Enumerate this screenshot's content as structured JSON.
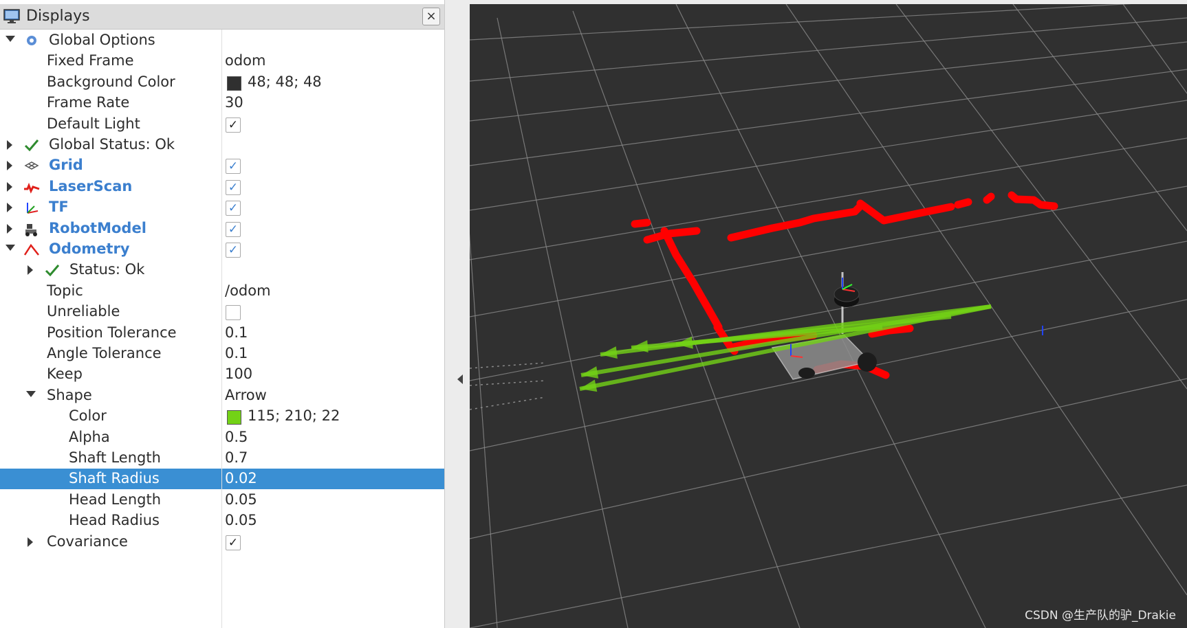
{
  "panel": {
    "title": "Displays",
    "close_symbol": "×",
    "rows": [
      {
        "label": "Global Options",
        "value": "",
        "depth": 0,
        "expander": "down",
        "icon": "gear-icon",
        "type": "text"
      },
      {
        "label": "Fixed Frame",
        "value": "odom",
        "depth": 1,
        "expander": "none",
        "type": "text"
      },
      {
        "label": "Background Color",
        "value": "48; 48; 48",
        "depth": 1,
        "expander": "none",
        "type": "color",
        "color": "#303030"
      },
      {
        "label": "Frame Rate",
        "value": "30",
        "depth": 1,
        "expander": "none",
        "type": "text"
      },
      {
        "label": "Default Light",
        "value": "",
        "depth": 1,
        "expander": "none",
        "type": "check",
        "checked": true,
        "mark": "black"
      },
      {
        "label": "Global Status: Ok",
        "value": "",
        "depth": 0,
        "expander": "right",
        "icon": "check-icon",
        "type": "text"
      },
      {
        "label": "Grid",
        "value": "",
        "depth": 0,
        "expander": "right",
        "icon": "grid-icon",
        "type": "check",
        "checked": true,
        "mark": "blue",
        "blue": true
      },
      {
        "label": "LaserScan",
        "value": "",
        "depth": 0,
        "expander": "right",
        "icon": "laserscan-icon",
        "type": "check",
        "checked": true,
        "mark": "blue",
        "blue": true
      },
      {
        "label": "TF",
        "value": "",
        "depth": 0,
        "expander": "right",
        "icon": "tf-icon",
        "type": "check",
        "checked": true,
        "mark": "blue",
        "blue": true
      },
      {
        "label": "RobotModel",
        "value": "",
        "depth": 0,
        "expander": "right",
        "icon": "robot-model-icon",
        "type": "check",
        "checked": true,
        "mark": "blue",
        "blue": true
      },
      {
        "label": "Odometry",
        "value": "",
        "depth": 0,
        "expander": "down",
        "icon": "odometry-icon",
        "type": "check",
        "checked": true,
        "mark": "blue",
        "blue": true
      },
      {
        "label": "Status: Ok",
        "value": "",
        "depth": 1,
        "expander": "right",
        "icon": "check-icon",
        "type": "text"
      },
      {
        "label": "Topic",
        "value": "/odom",
        "depth": 1,
        "expander": "none",
        "type": "text"
      },
      {
        "label": "Unreliable",
        "value": "",
        "depth": 1,
        "expander": "none",
        "type": "check",
        "checked": false,
        "mark": "black"
      },
      {
        "label": "Position Tolerance",
        "value": "0.1",
        "depth": 1,
        "expander": "none",
        "type": "text"
      },
      {
        "label": "Angle Tolerance",
        "value": "0.1",
        "depth": 1,
        "expander": "none",
        "type": "text"
      },
      {
        "label": "Keep",
        "value": "100",
        "depth": 1,
        "expander": "none",
        "type": "text"
      },
      {
        "label": "Shape",
        "value": "Arrow",
        "depth": 1,
        "expander": "down",
        "type": "text"
      },
      {
        "label": "Color",
        "value": "115; 210; 22",
        "depth": 2,
        "expander": "none",
        "type": "color",
        "color": "#73d216"
      },
      {
        "label": "Alpha",
        "value": "0.5",
        "depth": 2,
        "expander": "none",
        "type": "text"
      },
      {
        "label": "Shaft Length",
        "value": "0.7",
        "depth": 2,
        "expander": "none",
        "type": "text"
      },
      {
        "label": "Shaft Radius",
        "value": "0.02",
        "depth": 2,
        "expander": "none",
        "type": "text",
        "selected": true
      },
      {
        "label": "Head Length",
        "value": "0.05",
        "depth": 2,
        "expander": "none",
        "type": "text"
      },
      {
        "label": "Head Radius",
        "value": "0.05",
        "depth": 2,
        "expander": "none",
        "type": "text"
      },
      {
        "label": "Covariance",
        "value": "",
        "depth": 1,
        "expander": "right",
        "type": "check",
        "checked": true,
        "mark": "black"
      }
    ]
  },
  "viewport": {
    "background": "#303030",
    "grid_color": "#8a8a8a",
    "laser_color": "#ff0000",
    "odometry_color": "#73d216",
    "watermark": "CSDN @生产队的驴_Drakie"
  },
  "colors": {
    "selection": "#3a8fd3",
    "display_name": "#3b7fce"
  }
}
